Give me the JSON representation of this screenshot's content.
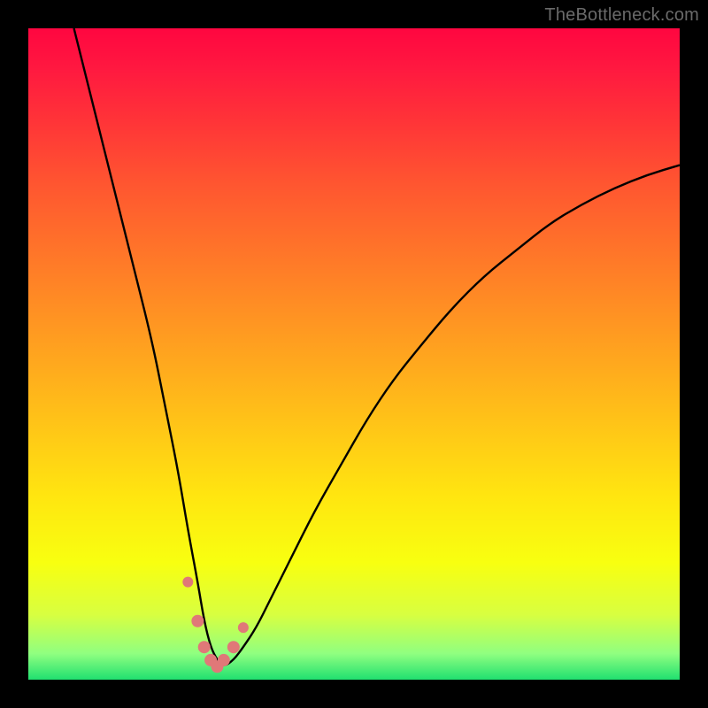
{
  "watermark": "TheBottleneck.com",
  "colors": {
    "page_bg": "#000000",
    "curve_stroke": "#000000",
    "marker_fill": "#e07878",
    "gradient_stops": [
      "#ff0640",
      "#ff1840",
      "#ff3338",
      "#ff5630",
      "#ff7a28",
      "#ff9e20",
      "#ffc218",
      "#ffe610",
      "#f8ff10",
      "#d8ff40",
      "#90ff80",
      "#20e070"
    ]
  },
  "chart_data": {
    "type": "line",
    "title": "",
    "xlabel": "",
    "ylabel": "",
    "xlim": [
      0,
      100
    ],
    "ylim": [
      0,
      100
    ],
    "series": [
      {
        "name": "bottleneck-curve",
        "x": [
          7,
          10,
          13,
          16,
          19,
          21,
          23,
          24.5,
          26,
          27,
          28,
          29,
          30,
          31.5,
          33,
          35,
          37,
          40,
          44,
          48,
          52,
          56,
          60,
          65,
          70,
          75,
          80,
          85,
          90,
          95,
          100
        ],
        "y": [
          100,
          88,
          76,
          64,
          52,
          42,
          32,
          23,
          15,
          9,
          5,
          3,
          2,
          3,
          5,
          8,
          12,
          18,
          26,
          33,
          40,
          46,
          51,
          57,
          62,
          66,
          70,
          73,
          75.5,
          77.5,
          79
        ]
      }
    ],
    "markers": {
      "name": "highlight-points",
      "x": [
        24.5,
        26,
        27,
        28,
        29,
        30,
        31.5,
        33
      ],
      "y": [
        15,
        9,
        5,
        3,
        2,
        3,
        5,
        8
      ]
    }
  }
}
